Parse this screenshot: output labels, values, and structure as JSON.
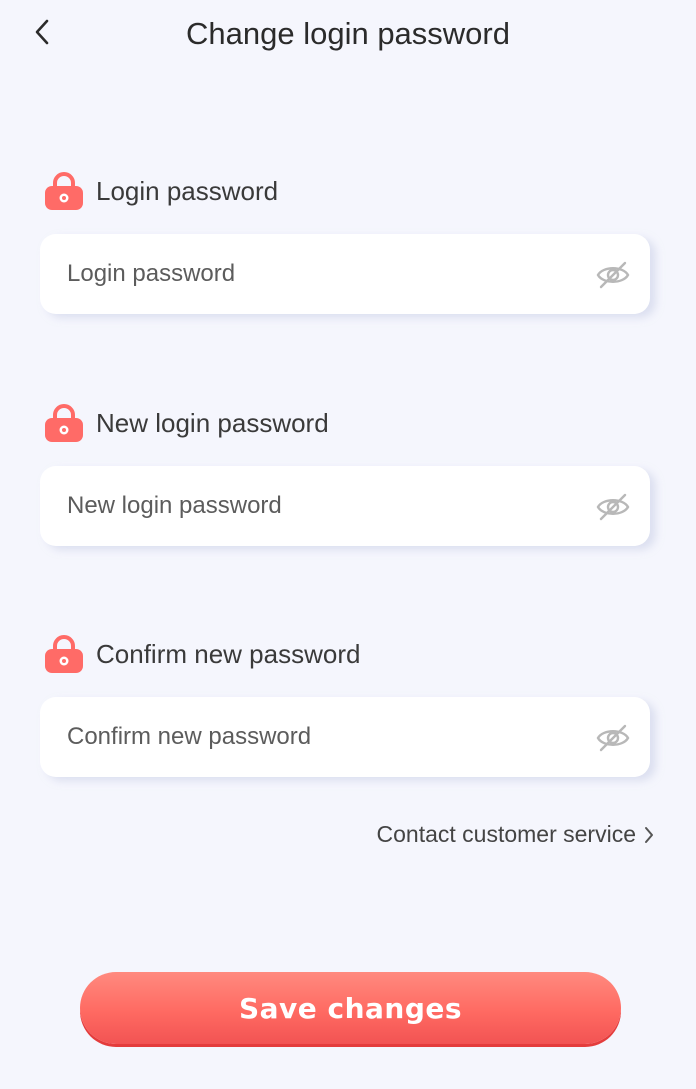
{
  "header": {
    "title": "Change login password",
    "back_icon": "chevron-left-icon"
  },
  "fields": [
    {
      "label": "Login password",
      "placeholder": "Login password",
      "value": "",
      "icon": "lock-icon",
      "toggle_icon": "eye-off-icon"
    },
    {
      "label": "New login password",
      "placeholder": "New login password",
      "value": "",
      "icon": "lock-icon",
      "toggle_icon": "eye-off-icon"
    },
    {
      "label": "Confirm new password",
      "placeholder": "Confirm new password",
      "value": "",
      "icon": "lock-icon",
      "toggle_icon": "eye-off-icon"
    }
  ],
  "contact": {
    "label": "Contact customer service",
    "icon": "chevron-right-icon"
  },
  "save_button": {
    "label": "Save changes"
  },
  "colors": {
    "background": "#f5f6fd",
    "accent": "#ff6a62",
    "lock": "#ff6b67",
    "eye_icon": "#b8b8b8",
    "card": "#ffffff"
  }
}
